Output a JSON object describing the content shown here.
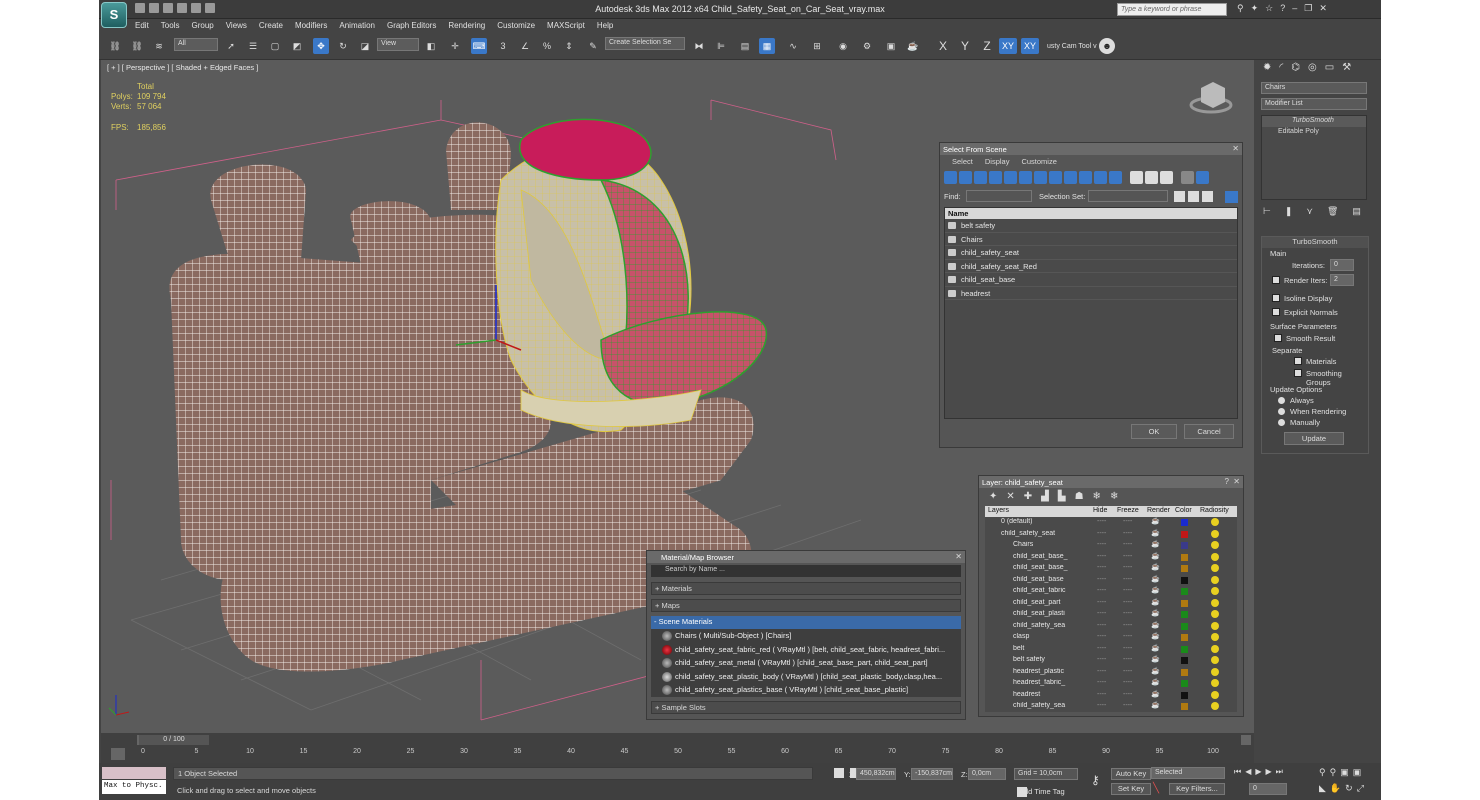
{
  "window": {
    "title": "Autodesk 3ds Max  2012 x64      Child_Safety_Seat_on_Car_Seat_vray.max",
    "search_placeholder": "Type a keyword or phrase",
    "logo": "S"
  },
  "menu": [
    "Edit",
    "Tools",
    "Group",
    "Views",
    "Create",
    "Modifiers",
    "Animation",
    "Graph Editors",
    "Rendering",
    "Customize",
    "MAXScript",
    "Help"
  ],
  "toolbar": {
    "filter": "All",
    "coord": "View",
    "selection_set": "Create Selection Se",
    "cam_tool": "usty Cam Tool v",
    "axis": [
      "X",
      "Y",
      "Z",
      "XY",
      "XY"
    ]
  },
  "viewport": {
    "label": "[ + ] [ Perspective ] [ Shaded + Edged Faces ]",
    "stats": {
      "total": "Total",
      "polys_label": "Polys:",
      "polys": "109 794",
      "verts_label": "Verts:",
      "verts": "57 064",
      "fps_label": "FPS:",
      "fps": "185,856"
    }
  },
  "command_panel": {
    "object_name": "Chairs",
    "modifier_list": "Modifier List",
    "stack": [
      "TurboSmooth",
      "Editable Poly"
    ],
    "turbosmooth": {
      "title": "TurboSmooth",
      "main": "Main",
      "iterations_label": "Iterations:",
      "iterations": "0",
      "render_iters_label": "Render Iters:",
      "render_iters": "2",
      "isoline": "Isoline Display",
      "explicit": "Explicit Normals",
      "surface_params": "Surface Parameters",
      "smooth_result": "Smooth Result",
      "separate": "Separate",
      "materials": "Materials",
      "smoothing_groups": "Smoothing Groups",
      "update_options": "Update Options",
      "always": "Always",
      "when_rendering": "When Rendering",
      "manually": "Manually",
      "update_btn": "Update"
    }
  },
  "select_dialog": {
    "title": "Select From Scene",
    "menu": [
      "Select",
      "Display",
      "Customize"
    ],
    "find_label": "Find:",
    "selset_label": "Selection Set:",
    "col_name": "Name",
    "items": [
      "belt safety",
      "Chairs",
      "child_safety_seat",
      "child_safety_seat_Red",
      "child_seat_base",
      "headrest"
    ],
    "ok": "OK",
    "cancel": "Cancel"
  },
  "layer_dialog": {
    "title": "Layer: child_safety_seat",
    "columns": [
      "Layers",
      "Hide",
      "Freeze",
      "Render",
      "Color",
      "Radiosity"
    ],
    "rows": [
      {
        "name": "0 (default)",
        "color": "#1a2ad0"
      },
      {
        "name": "child_safety_seat",
        "color": "#c01818"
      },
      {
        "name": "Chairs",
        "color": "#3a3a8a"
      },
      {
        "name": "child_seat_base_",
        "color": "#b07a10"
      },
      {
        "name": "child_seat_base_",
        "color": "#b07a10"
      },
      {
        "name": "child_seat_base",
        "color": "#111111"
      },
      {
        "name": "child_seat_fabric",
        "color": "#1a8a1a"
      },
      {
        "name": "child_seat_part",
        "color": "#b07a10"
      },
      {
        "name": "child_seat_plasti",
        "color": "#1a8a1a"
      },
      {
        "name": "child_safety_sea",
        "color": "#1a8a1a"
      },
      {
        "name": "clasp",
        "color": "#b07a10"
      },
      {
        "name": "belt",
        "color": "#1a8a1a"
      },
      {
        "name": "belt safety",
        "color": "#111111"
      },
      {
        "name": "headrest_plastic",
        "color": "#b07a10"
      },
      {
        "name": "headrest_fabric_",
        "color": "#1a8a1a"
      },
      {
        "name": "headrest",
        "color": "#111111"
      },
      {
        "name": "child_safety_sea",
        "color": "#b07a10"
      }
    ]
  },
  "material_browser": {
    "title": "Material/Map Browser",
    "search": "Search by Name ...",
    "groups": [
      "+ Materials",
      "+ Maps",
      "- Scene Materials",
      "+ Sample Slots"
    ],
    "items": [
      "Chairs  ( Multi/Sub-Object )  [Chairs]",
      "child_safety_seat_fabric_red  ( VRayMtl )  [belt, child_seat_fabric, headrest_fabri...",
      "child_safety_seat_metal  ( VRayMtl )  [child_seat_base_part, child_seat_part]",
      "child_safety_seat_plastic_body  ( VRayMtl )  [child_seat_plastic_body,clasp,hea...",
      "child_safety_seat_plastics_base  ( VRayMtl )  [child_seat_base_plastic]"
    ]
  },
  "timeline": {
    "frame": "0 / 100",
    "ticks": [
      "0",
      "5",
      "10",
      "15",
      "20",
      "25",
      "30",
      "35",
      "40",
      "45",
      "50",
      "55",
      "60",
      "65",
      "70",
      "75",
      "80",
      "85",
      "90",
      "95",
      "100"
    ]
  },
  "status": {
    "maxscript": "Max to Physc.",
    "selected": "1 Object Selected",
    "prompt": "Click and drag to select and move objects",
    "x_label": "X:",
    "x": "450,832cm",
    "y_label": "Y:",
    "y": "-150,837cm",
    "z_label": "Z:",
    "z": "0,0cm",
    "grid": "Grid = 10,0cm",
    "add_time_tag": "Add Time Tag",
    "auto_key": "Auto Key",
    "set_key": "Set Key",
    "key_mode": "Selected",
    "key_filters": "Key Filters...",
    "frame": "0"
  }
}
